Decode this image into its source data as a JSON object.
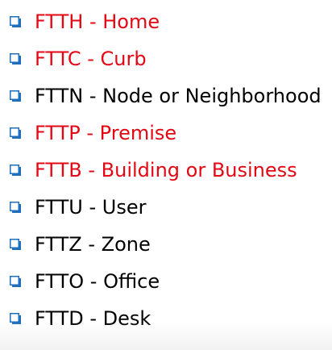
{
  "colors": {
    "bullet": "#1f6fbf",
    "red_text": "#e30613",
    "black_text": "#000000"
  },
  "bullet_icon": "square-bullet-icon",
  "items": [
    {
      "label": "FTTH - Home",
      "color": "#e30613"
    },
    {
      "label": "FTTC - Curb",
      "color": "#e30613"
    },
    {
      "label": "FTTN - Node or Neighborhood",
      "color": "#000000"
    },
    {
      "label": "FTTP - Premise",
      "color": "#e30613"
    },
    {
      "label": "FTTB - Building or Business",
      "color": "#e30613"
    },
    {
      "label": "FTTU - User",
      "color": "#000000"
    },
    {
      "label": "FTTZ - Zone",
      "color": "#000000"
    },
    {
      "label": "FTTO - Office",
      "color": "#000000"
    },
    {
      "label": "FTTD - Desk",
      "color": "#000000"
    }
  ]
}
